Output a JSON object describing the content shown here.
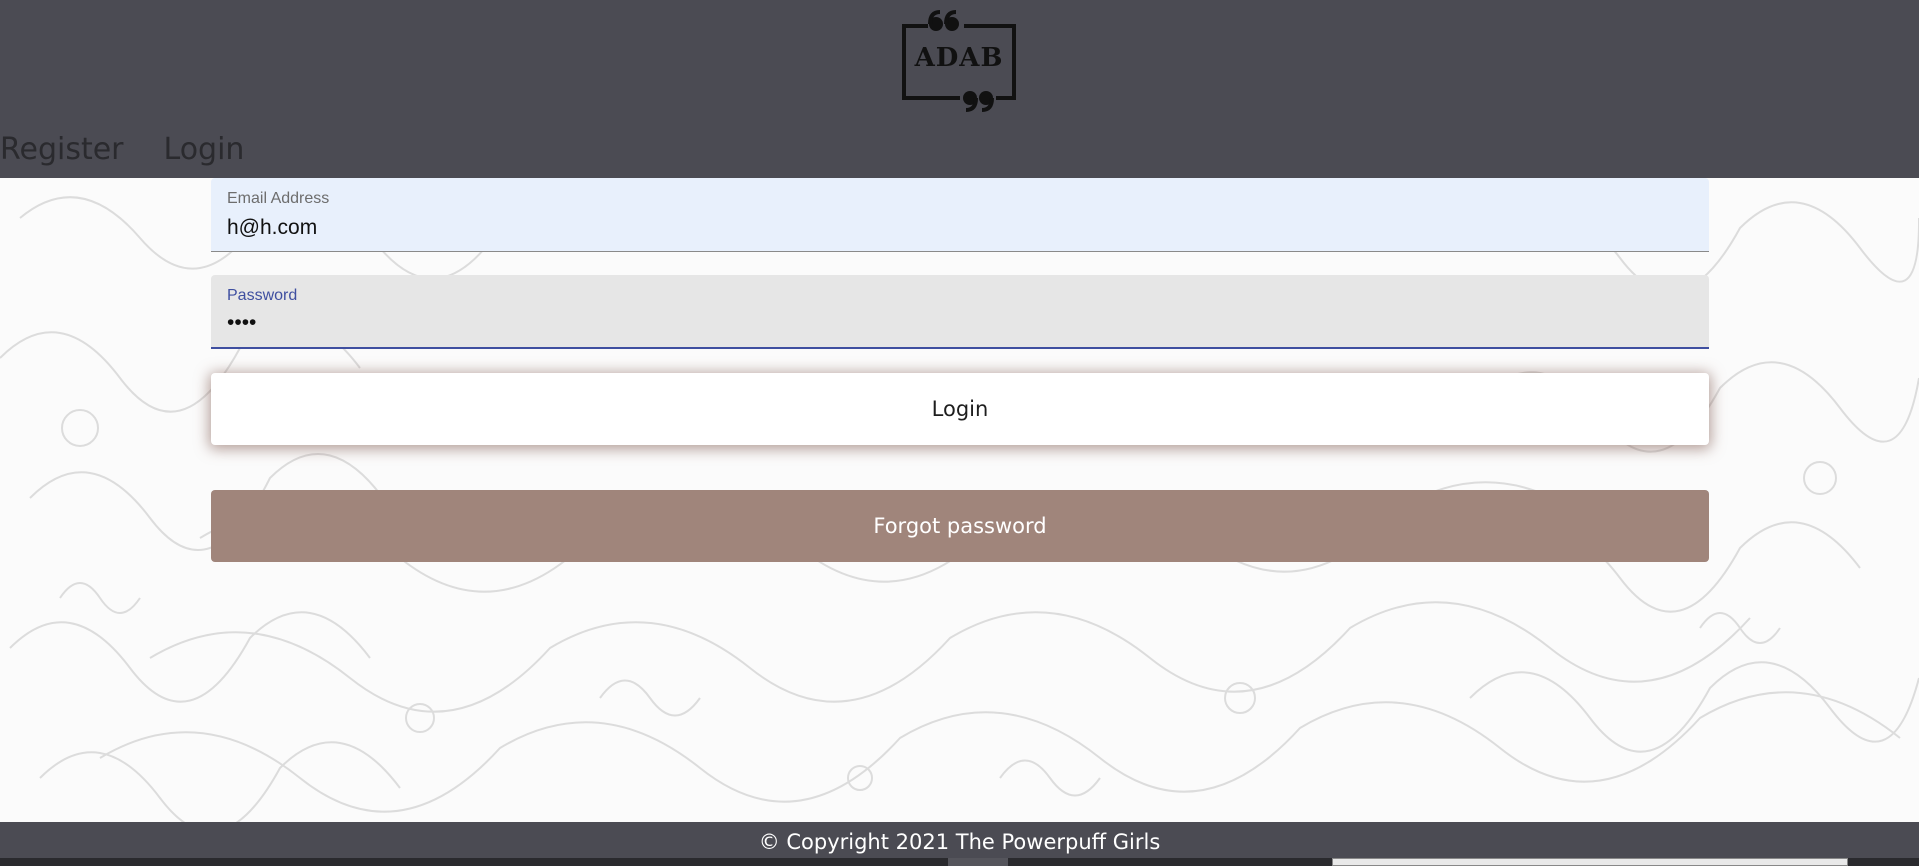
{
  "brand": {
    "logo_text": "ADAB",
    "logo_icon": "quote-bubble-icon"
  },
  "nav": {
    "items": [
      {
        "label": "Register"
      },
      {
        "label": "Login"
      }
    ]
  },
  "form": {
    "email": {
      "label": "Email Address",
      "value": "h@h.com"
    },
    "password": {
      "label": "Password",
      "value": "••••"
    },
    "login_button": "Login",
    "forgot_button": "Forgot password"
  },
  "footer": {
    "text": "© Copyright 2021 The Powerpuff Girls"
  },
  "colors": {
    "header_bg": "#4b4b53",
    "email_field_bg": "#e8f0fc",
    "password_field_bg": "#e6e6e6",
    "focus_underline": "#3f4fa0",
    "forgot_button_bg": "#a0857b",
    "login_button_shadow": "#78503f"
  }
}
